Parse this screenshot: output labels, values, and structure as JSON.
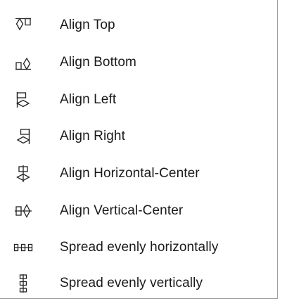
{
  "menu": {
    "items": [
      {
        "label": "Align Top",
        "icon": "align-top-icon"
      },
      {
        "label": "Align Bottom",
        "icon": "align-bottom-icon"
      },
      {
        "label": "Align Left",
        "icon": "align-left-icon"
      },
      {
        "label": "Align Right",
        "icon": "align-right-icon"
      },
      {
        "label": "Align Horizontal-Center",
        "icon": "align-horizontal-center-icon"
      },
      {
        "label": "Align Vertical-Center",
        "icon": "align-vertical-center-icon"
      },
      {
        "label": "Spread evenly horizontally",
        "icon": "spread-horizontal-icon"
      },
      {
        "label": "Spread evenly vertically",
        "icon": "spread-vertical-icon"
      }
    ]
  },
  "colors": {
    "text": "#1a1a1a",
    "icon": "#222222",
    "border": "#a0a0a0",
    "background": "#ffffff"
  }
}
